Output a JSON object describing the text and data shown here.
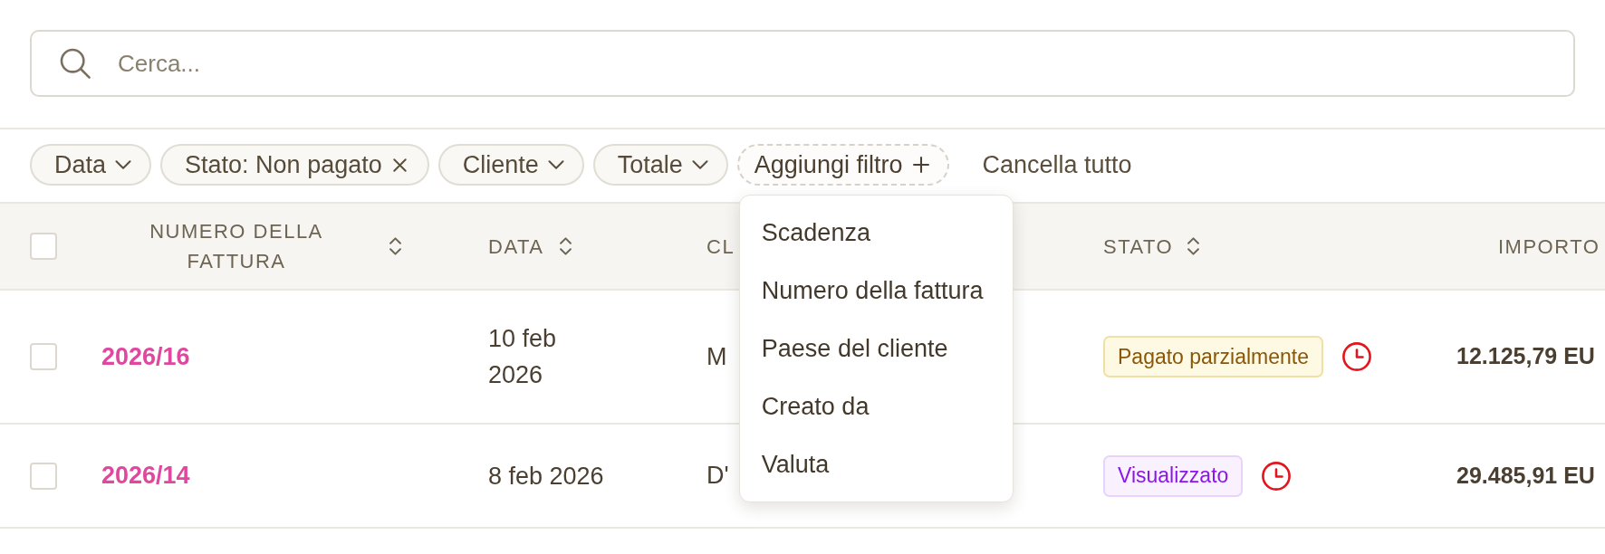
{
  "search": {
    "placeholder": "Cerca..."
  },
  "filters": [
    {
      "kind": "dropdown",
      "label": "Data"
    },
    {
      "kind": "removable",
      "label": "Stato: Non pagato"
    },
    {
      "kind": "dropdown",
      "label": "Cliente"
    },
    {
      "kind": "dropdown",
      "label": "Totale"
    }
  ],
  "add_filter": {
    "label": "Aggiungi filtro",
    "expanded": true,
    "menu": [
      "Scadenza",
      "Numero della fattura",
      "Paese del cliente",
      "Creato da",
      "Valuta"
    ]
  },
  "clear_all": "Cancella tutto",
  "table": {
    "select_all": {
      "checked": false
    },
    "columns": [
      {
        "label": "NUMERO DELLA FATTURA",
        "sortable": true
      },
      {
        "label": "DATA",
        "sortable": true
      },
      {
        "label": "CL",
        "sortable": false
      },
      {
        "label": "STATO",
        "sortable": true
      },
      {
        "label": "IMPORTO",
        "sortable": false
      }
    ],
    "rows": [
      {
        "checked": false,
        "number": "2026/16",
        "date": "10 feb 2026",
        "client": "M",
        "status": {
          "kind": "partial",
          "label": "Pagato parzialmente"
        },
        "overdue": true,
        "amount": "12.125,79 EU"
      },
      {
        "checked": false,
        "number": "2026/14",
        "date": "8 feb 2026",
        "client": "D'",
        "status": {
          "kind": "viewed",
          "label": "Visualizzato"
        },
        "overdue": true,
        "amount": "29.485,91 EU"
      }
    ]
  }
}
